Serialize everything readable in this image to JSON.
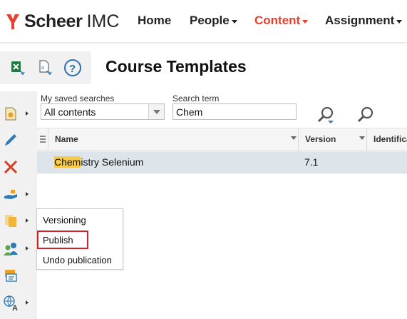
{
  "brand": {
    "name_bold": "Scheer",
    "name_light": "IMC",
    "mark_color": "#e8402f"
  },
  "nav": {
    "items": [
      {
        "label": "Home",
        "dropdown": false,
        "active": false
      },
      {
        "label": "People",
        "dropdown": true,
        "active": false
      },
      {
        "label": "Content",
        "dropdown": true,
        "active": true
      },
      {
        "label": "Assignment",
        "dropdown": true,
        "active": false
      }
    ],
    "active_color": "#e8402f"
  },
  "toolbar": {
    "icons": [
      "excel-export-icon",
      "pdf-export-icon",
      "help-icon"
    ]
  },
  "page": {
    "title": "Course Templates"
  },
  "search": {
    "saved_label": "My saved searches",
    "saved_value": "All contents",
    "term_label": "Search term",
    "term_value": "Chem",
    "icons": [
      "advanced-search-icon",
      "search-icon"
    ]
  },
  "grid": {
    "columns": [
      "Name",
      "Version",
      "Identifica"
    ],
    "rows": [
      {
        "name_highlight": "Chem",
        "name_rest": "istry Selenium",
        "version": "7.1",
        "identifier": ""
      }
    ],
    "highlight_color": "#f7c948",
    "selected_row_color": "#dde4ea"
  },
  "sidebar": {
    "icons": [
      "new-item-icon",
      "edit-icon",
      "delete-icon",
      "hand-share-icon",
      "copy-pages-icon",
      "users-icon",
      "gallery-icon",
      "language-icon"
    ]
  },
  "context_menu": {
    "items": [
      {
        "label": "Versioning",
        "outlined": false
      },
      {
        "label": "Publish",
        "outlined": true
      },
      {
        "label": "Undo publication",
        "outlined": false
      }
    ],
    "outline_color": "#d0202a"
  }
}
